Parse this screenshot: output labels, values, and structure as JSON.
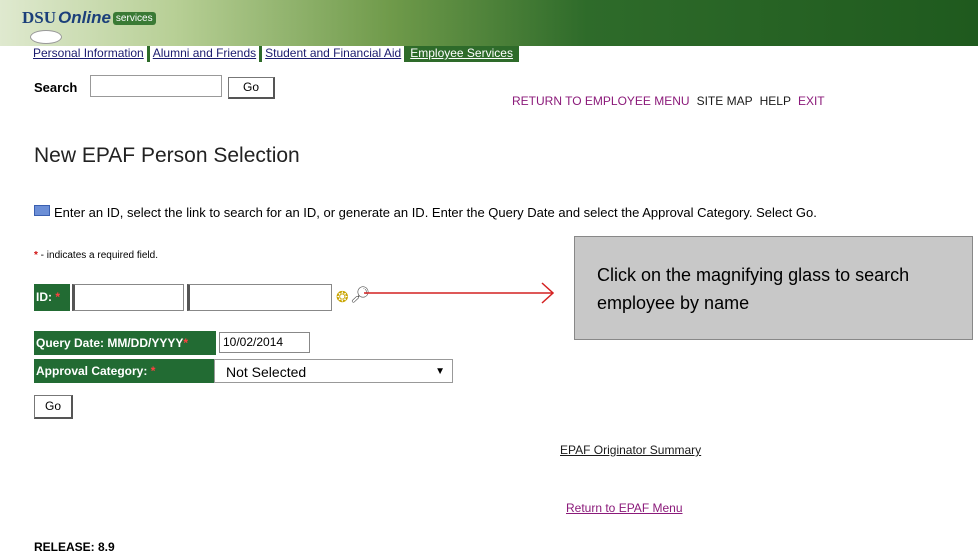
{
  "header": {
    "logo": {
      "dsu": "DSU",
      "online": "Online",
      "services": "services"
    },
    "tabs": [
      {
        "label": "Personal Information",
        "active": false
      },
      {
        "label": "Alumni and Friends",
        "active": false
      },
      {
        "label": "Student and Financial Aid",
        "active": false
      },
      {
        "label": "Employee Services",
        "active": true
      }
    ]
  },
  "search": {
    "label": "Search",
    "value": "",
    "go_label": "Go"
  },
  "top_links": {
    "return_employee": "RETURN TO EMPLOYEE MENU",
    "site_map": "SITE MAP",
    "help": "HELP",
    "exit": "EXIT"
  },
  "page_title": "New EPAF Person Selection",
  "instructions": "Enter an ID, select the link to search for an ID, or generate an ID. Enter the Query Date and select the Approval Category. Select Go.",
  "required_note": {
    "star": "*",
    "text": " - indicates a required field."
  },
  "form": {
    "id_label": "ID:",
    "id_value": "",
    "id_name_value": "",
    "query_date_label": "Query Date: MM/DD/YYYY",
    "query_date_value": "10/02/2014",
    "approval_label": "Approval Category:",
    "approval_value": "Not Selected",
    "go_label": "Go"
  },
  "callout": {
    "text": "Click on the magnifying glass to search employee by name"
  },
  "links": {
    "originator_summary": "EPAF Originator Summary",
    "return_epaf": "Return to EPAF Menu"
  },
  "release": "RELEASE: 8.9",
  "colors": {
    "label_bg": "#226b33",
    "link_purple": "#8b1a7a",
    "required_star": "#d01010",
    "arrow": "#d42020"
  },
  "icons": {
    "info": "comment-icon",
    "generate_id": "generate-id-icon",
    "search_person": "magnifying-glass-icon"
  }
}
